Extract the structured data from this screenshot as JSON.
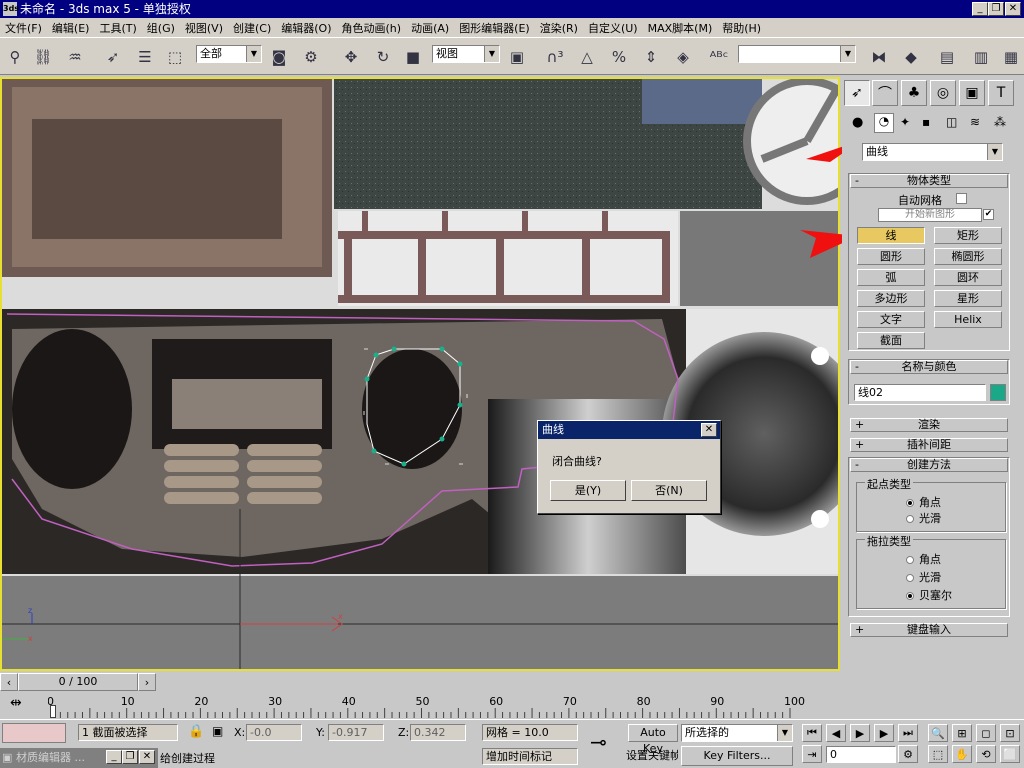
{
  "window": {
    "title": "未命名 - 3ds max 5 - 单独授权",
    "app_icon": "3ds"
  },
  "menu": [
    "文件(F)",
    "编辑(E)",
    "工具(T)",
    "组(G)",
    "视图(V)",
    "创建(C)",
    "编辑器(O)",
    "角色动画(h)",
    "动画(A)",
    "图形编辑器(E)",
    "渲染(R)",
    "自定义(U)",
    "MAX脚本(M)",
    "帮助(H)"
  ],
  "toolbar": {
    "selection_filter": "全部",
    "ref_coord": "视图",
    "named_selection": "",
    "icons": [
      "select-link-icon",
      "unlink-icon",
      "bind-spacewarp-icon",
      "select-icon",
      "select-by-name-icon",
      "rect-select-icon",
      "window-crossing-icon",
      "select-move-icon",
      "select-rotate-icon",
      "select-scale-icon",
      "pivot-icon",
      "manipulate-icon",
      "snap-3d-icon",
      "angle-snap-icon",
      "percent-snap-icon",
      "spinner-snap-icon",
      "named-sets-icon",
      "mirror-icon",
      "align-icon",
      "layer-icon",
      "curve-editor-icon",
      "schematic-icon",
      "material-editor-icon",
      "render-icon"
    ]
  },
  "command_panel": {
    "category_dropdown": "曲线",
    "object_type": {
      "header": "物体类型",
      "auto_grid": "自动网格",
      "start_new_shape": "开始新图形",
      "buttons": [
        "线",
        "矩形",
        "圆形",
        "椭圆形",
        "弧",
        "圆环",
        "多边形",
        "星形",
        "文字",
        "Helix",
        "截面"
      ],
      "active": "线"
    },
    "name_color": {
      "header": "名称与颜色",
      "name": "线02",
      "color": "#1aa888"
    },
    "rollouts": [
      "渲染",
      "插补间距",
      "创建方法"
    ],
    "initial_type": {
      "label": "起点类型",
      "options": [
        "角点",
        "光滑"
      ],
      "selected": "角点"
    },
    "drag_type": {
      "label": "拖拉类型",
      "options": [
        "角点",
        "光滑",
        "贝塞尔"
      ],
      "selected": "贝塞尔"
    },
    "keyboard_input": "键盘输入"
  },
  "dialog": {
    "title": "曲线",
    "message": "闭合曲线?",
    "yes": "是(Y)",
    "no": "否(N)"
  },
  "timeline": {
    "position": "0 / 100",
    "ticks": [
      "0",
      "10",
      "20",
      "30",
      "40",
      "50",
      "60",
      "70",
      "80",
      "90",
      "100"
    ]
  },
  "status": {
    "selected_count": "1 截面被选择",
    "x": "-0.0",
    "y": "-0.917",
    "z": "0.342",
    "x_label": "X:",
    "y_label": "Y:",
    "z_label": "Z:",
    "grid": "网格 = 10.0",
    "auto_key": "Auto Key",
    "selected_set": "所选择的",
    "set_key": "设置关键帧",
    "key_filters": "Key Filters...",
    "add_time_tag": "增加时间标记",
    "prompt": "给创建过程",
    "frame": "0",
    "material_editor": "材质编辑器 ..."
  }
}
